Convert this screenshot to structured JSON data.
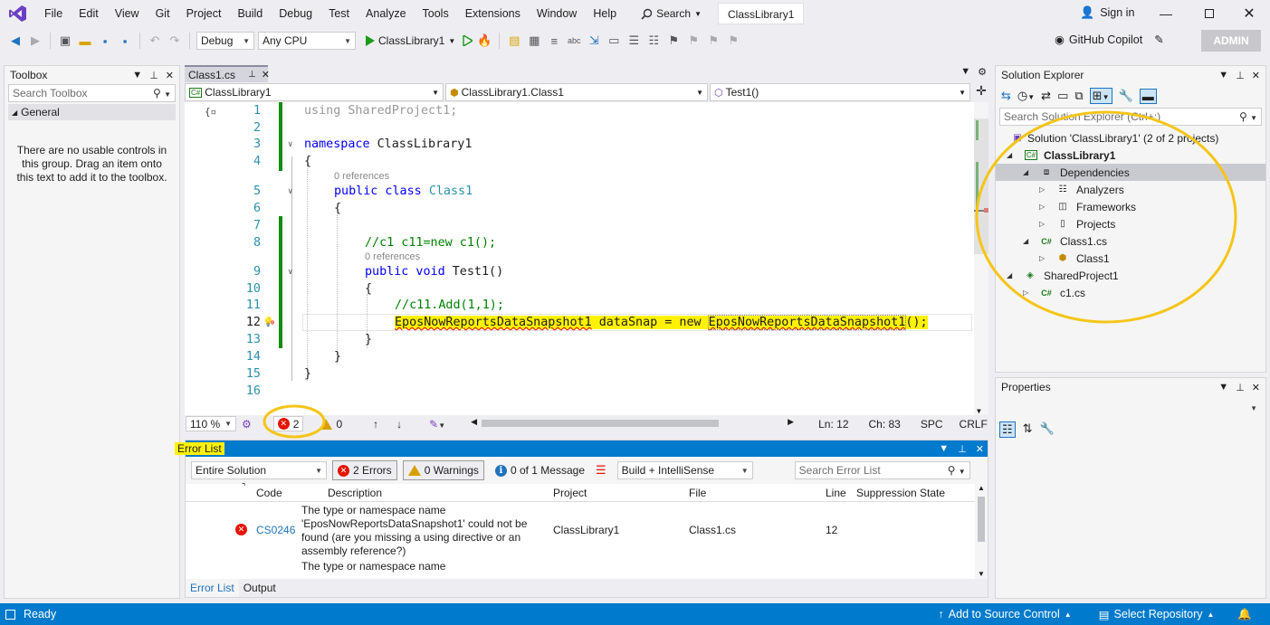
{
  "menu": {
    "items": [
      "File",
      "Edit",
      "View",
      "Git",
      "Project",
      "Build",
      "Debug",
      "Test",
      "Analyze",
      "Tools",
      "Extensions",
      "Window",
      "Help"
    ],
    "search_label": "Search",
    "solution_name": "ClassLibrary1",
    "sign_in": "Sign in"
  },
  "toolbar": {
    "config": "Debug",
    "platform": "Any CPU",
    "run_target": "ClassLibrary1",
    "copilot": "GitHub Copilot",
    "admin": "ADMIN"
  },
  "toolbox": {
    "title": "Toolbox",
    "search_placeholder": "Search Toolbox",
    "group": "General",
    "empty_message": "There are no usable controls in this group. Drag an item onto this text to add it to the toolbox."
  },
  "editor": {
    "tab": "Class1.cs",
    "nav_project": "ClassLibrary1",
    "nav_class": "ClassLibrary1.Class1",
    "nav_member": "Test1()",
    "references_label": "0 references",
    "lines": [
      {
        "n": "1",
        "kw": "using",
        "rest": " SharedProject1;"
      },
      {
        "n": "2"
      },
      {
        "n": "3",
        "kw": "namespace",
        "rest": " ClassLibrary1"
      },
      {
        "n": "4",
        "rest": "{"
      },
      {
        "n": "5",
        "kw": "public class",
        "type": "Class1"
      },
      {
        "n": "6",
        "rest": "{"
      },
      {
        "n": "7"
      },
      {
        "n": "8",
        "comment": "//c1 c11=new c1();"
      },
      {
        "n": "9",
        "kw": "public void",
        "rest": " Test1()"
      },
      {
        "n": "10",
        "rest": "{"
      },
      {
        "n": "11",
        "comment": "//c11.Add(1,1);"
      },
      {
        "n": "12",
        "t1": "EposNowReportsDataSnapshot1",
        "t2": " dataSnap = new ",
        "t3": "EposNowReportsDataSnapshot1",
        "t4": "();"
      },
      {
        "n": "13",
        "rest": "}"
      },
      {
        "n": "14",
        "rest": "}"
      },
      {
        "n": "15",
        "rest": "}"
      },
      {
        "n": "16"
      }
    ],
    "zoom": "110 %",
    "error_count": "2",
    "warning_count": "0",
    "position_ln": "Ln: 12",
    "position_ch": "Ch: 83",
    "spc": "SPC",
    "crlf": "CRLF"
  },
  "error_list": {
    "title": "Error List",
    "scope": "Entire Solution",
    "errors_btn": "2 Errors",
    "warnings_btn": "0 Warnings",
    "messages_btn": "0 of 1 Message",
    "build_filter": "Build + IntelliSense",
    "search_placeholder": "Search Error List",
    "columns": {
      "code": "Code",
      "description": "Description",
      "project": "Project",
      "file": "File",
      "line": "Line",
      "suppression": "Suppression State"
    },
    "rows": [
      {
        "code": "CS0246",
        "description": "The type or namespace name 'EposNowReportsDataSnapshot1' could not be found (are you missing a using directive or an assembly reference?)",
        "project": "ClassLibrary1",
        "file": "Class1.cs",
        "line": "12"
      },
      {
        "description": "The type or namespace name"
      }
    ],
    "tabs": [
      "Error List",
      "Output"
    ]
  },
  "solution_explorer": {
    "title": "Solution Explorer",
    "search_placeholder": "Search Solution Explorer (Ctrl+;)",
    "tree": [
      {
        "label": "Solution 'ClassLibrary1' (2 of 2 projects)",
        "depth": 0
      },
      {
        "label": "ClassLibrary1",
        "depth": 1
      },
      {
        "label": "Dependencies",
        "depth": 2
      },
      {
        "label": "Analyzers",
        "depth": 3
      },
      {
        "label": "Frameworks",
        "depth": 3
      },
      {
        "label": "Projects",
        "depth": 3
      },
      {
        "label": "Class1.cs",
        "depth": 2
      },
      {
        "label": "Class1",
        "depth": 3
      },
      {
        "label": "SharedProject1",
        "depth": 1
      },
      {
        "label": "c1.cs",
        "depth": 2
      }
    ]
  },
  "properties": {
    "title": "Properties"
  },
  "statusbar": {
    "ready": "Ready",
    "source_control": "Add to Source Control",
    "repository": "Select Repository"
  },
  "colors": {
    "accent": "#007acc",
    "highlight": "#fff200",
    "annotation": "#f5c518",
    "error": "#e51400"
  }
}
